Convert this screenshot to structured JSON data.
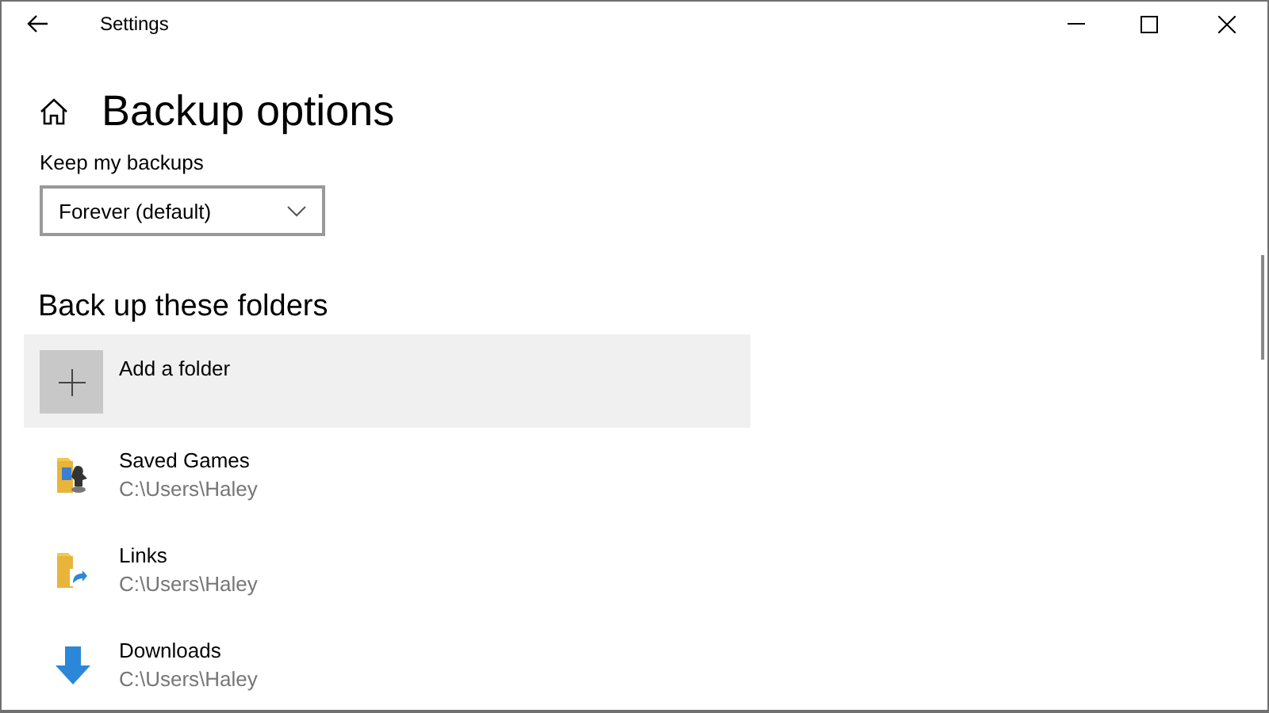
{
  "window": {
    "title": "Settings"
  },
  "page": {
    "title": "Backup options"
  },
  "keep_backups": {
    "label": "Keep my backups",
    "value": "Forever (default)"
  },
  "folders_section": {
    "title": "Back up these folders",
    "add_label": "Add a folder",
    "folders": [
      {
        "kind": "games",
        "name": "Saved Games",
        "path": "C:\\Users\\Haley"
      },
      {
        "kind": "links",
        "name": "Links",
        "path": "C:\\Users\\Haley"
      },
      {
        "kind": "downloads",
        "name": "Downloads",
        "path": "C:\\Users\\Haley"
      }
    ]
  }
}
